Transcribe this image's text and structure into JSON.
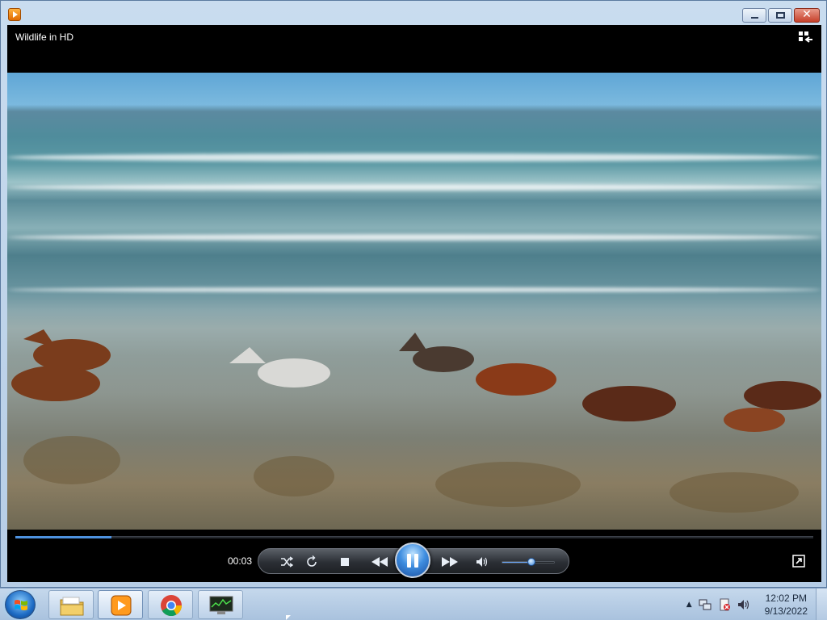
{
  "window": {
    "app_icon": "media-player-icon",
    "buttons": {
      "minimize": "minimize-icon",
      "maximize": "maximize-icon",
      "close": "close-icon",
      "close_glyph": "✕"
    }
  },
  "player": {
    "title": "Wildlife in HD",
    "switch_to_library_icon": "switch-to-library-icon",
    "progress": 0.12,
    "elapsed": "00:03",
    "controls": {
      "shuffle": "shuffle-icon",
      "repeat": "repeat-icon",
      "stop": "stop-icon",
      "previous": "previous-icon",
      "play_pause": "pause-icon",
      "next": "next-icon",
      "mute": "speaker-icon"
    },
    "volume": 0.55,
    "fullscreen_icon": "fullscreen-icon"
  },
  "colors": {
    "accent": "#4d92e0",
    "close_red": "#c7402a",
    "video_bg": "#000000"
  },
  "taskbar": {
    "start_icon": "windows-start-icon",
    "pinned": [
      "file-explorer-icon",
      "media-player-icon",
      "chrome-icon",
      "task-manager-icon"
    ],
    "tray": {
      "show_hidden": "▲",
      "icons": [
        "network-icon",
        "action-center-icon",
        "volume-icon"
      ],
      "time": "12:02 PM",
      "date": "9/13/2022"
    }
  }
}
